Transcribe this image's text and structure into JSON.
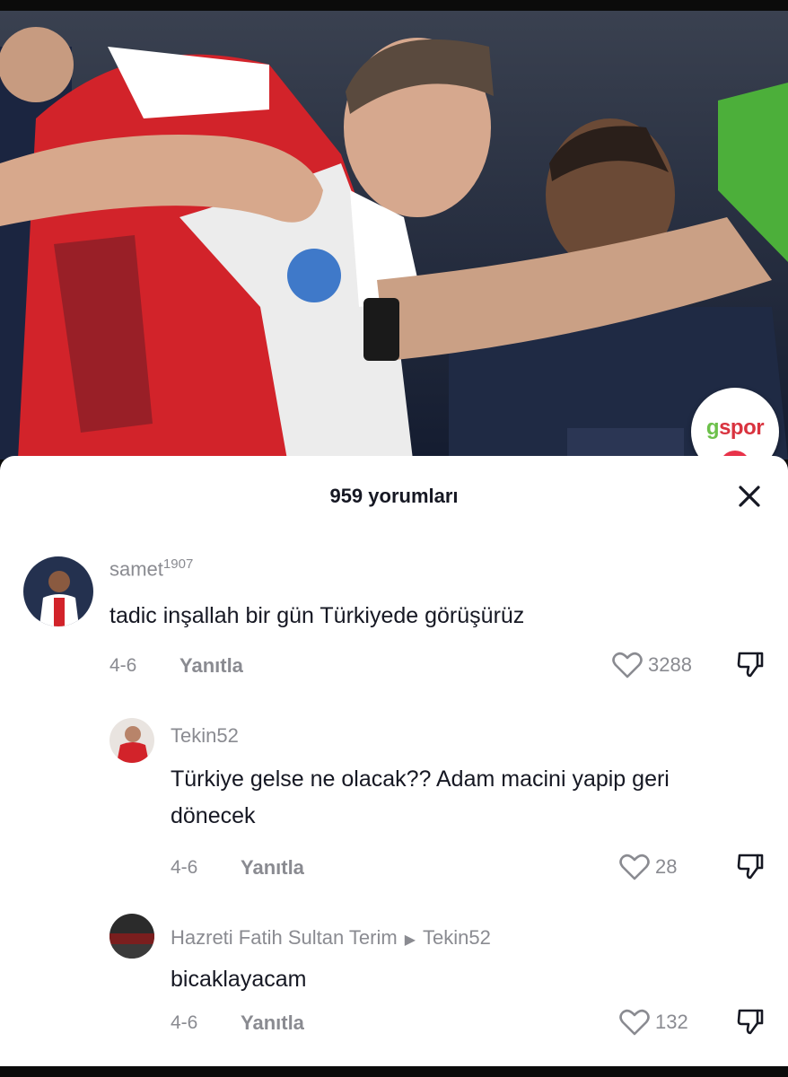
{
  "video": {
    "overlay_logo_text": "gspor",
    "colors": {
      "home_kit_red": "#d2232a",
      "keeper_green": "#4caf3a",
      "away_navy": "#1f2a44"
    }
  },
  "comments_panel": {
    "title": "959 yorumları",
    "close_icon": "close-icon",
    "comments": [
      {
        "username": "samet",
        "username_suffix": "1907",
        "text": "tadic inşallah bir gün Türkiyede görüşürüz",
        "date": "4-6",
        "reply_label": "Yanıtla",
        "likes": "3288"
      },
      {
        "username": "Tekin52",
        "text": "Türkiye gelse ne olacak?? Adam macini yapip geri dönecek",
        "date": "4-6",
        "reply_label": "Yanıtla",
        "likes": "28"
      },
      {
        "username": "Hazreti Fatih Sultan Terim",
        "reply_to": "Tekin52",
        "text": "bicaklayacam",
        "date": "4-6",
        "reply_label": "Yanıtla",
        "likes": "132"
      }
    ]
  }
}
